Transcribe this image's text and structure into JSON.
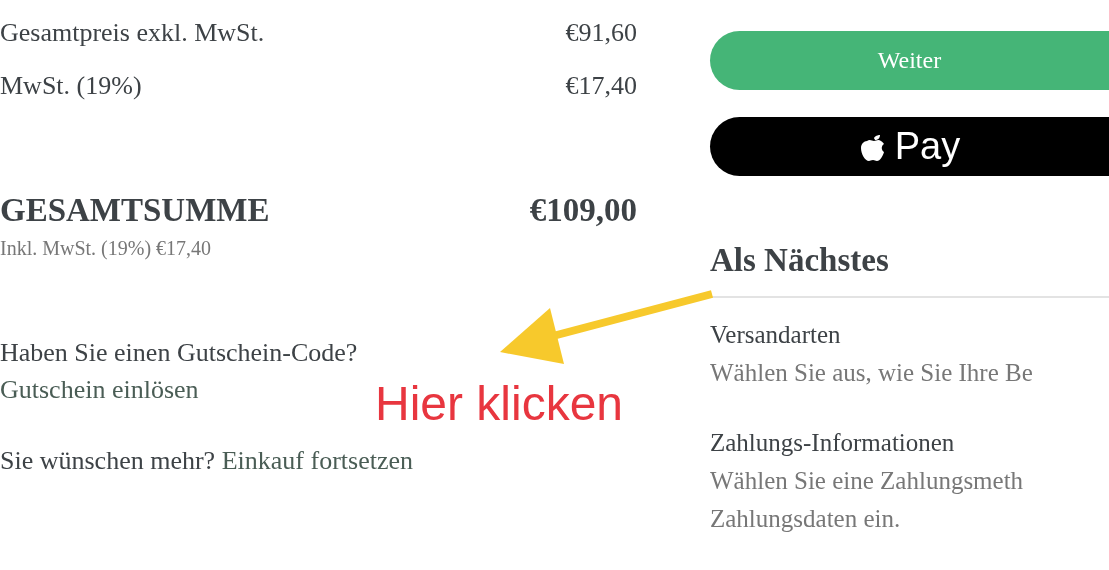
{
  "summary": {
    "lines": [
      {
        "label": "Gesamtpreis exkl. MwSt.",
        "value": "€91,60"
      },
      {
        "label": "MwSt. (19%)",
        "value": "€17,40"
      }
    ],
    "total": {
      "label": "GESAMTSUMME",
      "value": "€109,00",
      "note": "Inkl. MwSt. (19%) €17,40"
    },
    "coupon": {
      "question": "Haben Sie einen Gutschein-Code?",
      "link": "Gutschein einlösen"
    },
    "more": {
      "text": "Sie wünschen mehr?",
      "link": "Einkauf fortsetzen"
    }
  },
  "actions": {
    "continue": "Weiter",
    "apple_pay": "Pay"
  },
  "next": {
    "title": "Als Nächstes",
    "steps": [
      {
        "title": "Versandarten",
        "lines": [
          "Wählen Sie aus, wie Sie Ihre Be"
        ]
      },
      {
        "title": "Zahlungs-Informationen",
        "lines": [
          "Wählen Sie eine Zahlungsmeth",
          "Zahlungsdaten ein."
        ]
      }
    ]
  },
  "annotation": {
    "text": "Hier klicken"
  }
}
